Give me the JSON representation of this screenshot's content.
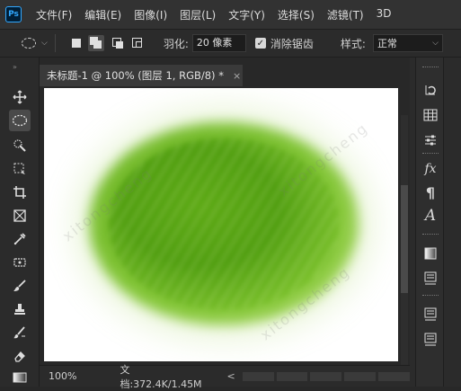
{
  "app": {
    "logo_text": "Ps"
  },
  "menu": {
    "items": [
      "文件(F)",
      "编辑(E)",
      "图像(I)",
      "图层(L)",
      "文字(Y)",
      "选择(S)",
      "滤镜(T)",
      "3D"
    ]
  },
  "options": {
    "feather_label": "羽化:",
    "feather_value": "20 像素",
    "antialias_checked": true,
    "antialias_label": "消除锯齿",
    "style_label": "样式:",
    "style_value": "正常",
    "selection_modes": [
      "new-selection",
      "add-to-selection",
      "subtract-from-selection",
      "intersect-with-selection"
    ]
  },
  "document": {
    "tab_title": "未标题-1 @ 100% (图层 1, RGB/8) *",
    "tab_close": "×",
    "zoom": "100%",
    "doc_info": "文档:372.4K/1.45M",
    "status_arrow": "<"
  },
  "left_tools": [
    "move-icon",
    "elliptical-marquee-icon",
    "quick-selection-icon",
    "crop-icon",
    "frame-icon",
    "eyedropper-icon",
    "healing-brush-icon",
    "brush-icon",
    "clone-stamp-icon",
    "history-brush-icon",
    "eraser-icon",
    "gradient-icon"
  ],
  "right_panels": [
    "history-icon",
    "swatches-icon",
    "adjustments-icon",
    "fx-icon",
    "paragraph-icon",
    "character-icon",
    "color-icon",
    "layers-icon",
    "channels-icon"
  ],
  "colors": {
    "accent": "#31a8ff",
    "ui_dark": "#282828",
    "leaf_green": "#5eaa17"
  }
}
